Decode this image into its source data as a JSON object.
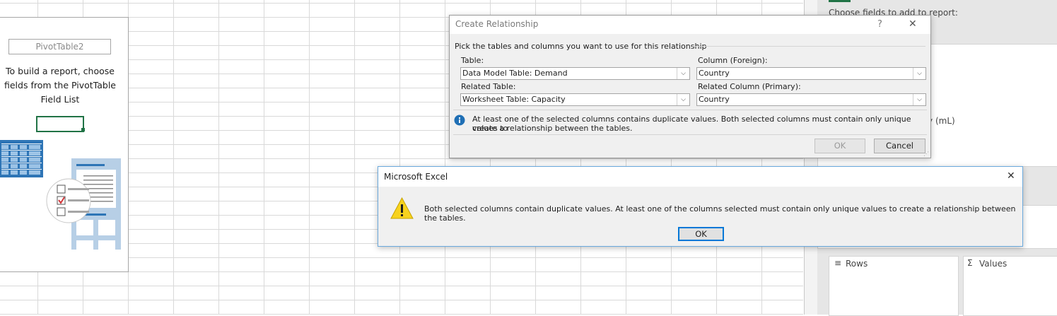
{
  "pivot": {
    "name": "PivotTable2",
    "instructions_line1": "To build a report, choose",
    "instructions_line2": "fields from the PivotTable",
    "instructions_line3": "Field List"
  },
  "field_list": {
    "choose_fields_label": "Choose fields to add to report:",
    "partial_field": "ity (mL)",
    "rows_label": "Rows",
    "values_label": "Values",
    "rows_icon": "rows-icon",
    "values_icon": "sigma-icon"
  },
  "create_relationship": {
    "title": "Create Relationship",
    "help_glyph": "?",
    "close_glyph": "✕",
    "heading": "Pick the tables and columns you want to use for this relationship",
    "table_label": "Table:",
    "table_value": "Data Model Table: Demand",
    "column_foreign_label": "Column (Foreign):",
    "column_foreign_value": "Country",
    "related_table_label": "Related Table:",
    "related_table_value": "Worksheet Table: Capacity",
    "related_column_label": "Related Column (Primary):",
    "related_column_value": "Country",
    "info_line1": "At least one of the selected columns contains duplicate values. Both selected columns must contain only unique values to",
    "info_line2": "create a relationship between the tables.",
    "ok_label": "OK",
    "cancel_label": "Cancel"
  },
  "excel_alert": {
    "title": "Microsoft Excel",
    "close_glyph": "✕",
    "message": "Both selected columns contain duplicate values. At least one of the columns selected must contain only unique values to create a relationship between the tables.",
    "ok_label": "OK",
    "icon": "warning-icon"
  },
  "colors": {
    "excel_green": "#217346",
    "warning_yellow": "#f7d21e",
    "info_blue": "#1f6fb5",
    "focus_blue": "#0078d7"
  }
}
